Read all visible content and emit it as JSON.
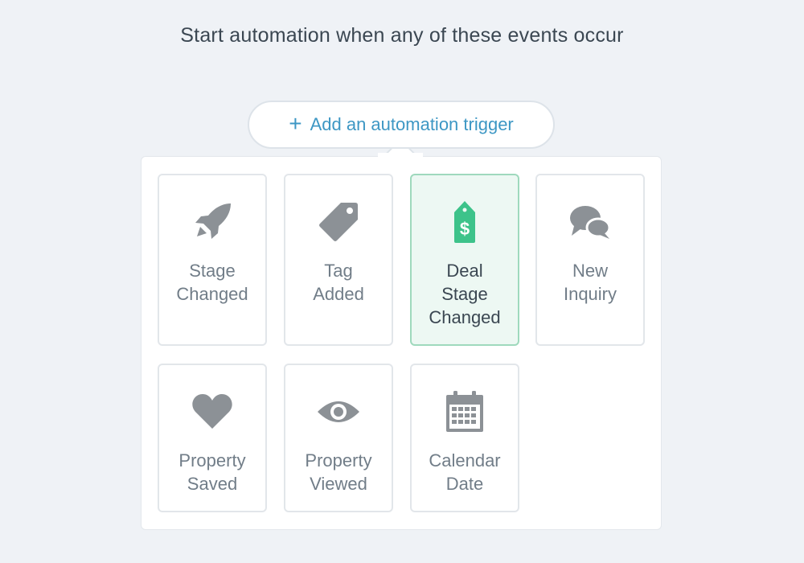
{
  "heading": "Start automation when any of these events occur",
  "trigger_button": {
    "icon": "plus",
    "label": "Add an automation trigger"
  },
  "colors": {
    "accent": "#3d97c4",
    "selected_icon": "#3dc38a",
    "icon": "#8c9196"
  },
  "triggers": [
    {
      "icon": "rocket-icon",
      "lines": [
        "Stage",
        "Changed"
      ],
      "selected": false
    },
    {
      "icon": "tag-icon",
      "lines": [
        "Tag",
        "Added"
      ],
      "selected": false
    },
    {
      "icon": "price-tag-dollar-icon",
      "lines": [
        "Deal",
        "Stage",
        "Changed"
      ],
      "selected": true
    },
    {
      "icon": "chat-bubbles-icon",
      "lines": [
        "New",
        "Inquiry"
      ],
      "selected": false
    },
    {
      "icon": "heart-icon",
      "lines": [
        "Property",
        "Saved"
      ],
      "selected": false
    },
    {
      "icon": "eye-icon",
      "lines": [
        "Property",
        "Viewed"
      ],
      "selected": false
    },
    {
      "icon": "calendar-icon",
      "lines": [
        "Calendar",
        "Date"
      ],
      "selected": false
    }
  ]
}
